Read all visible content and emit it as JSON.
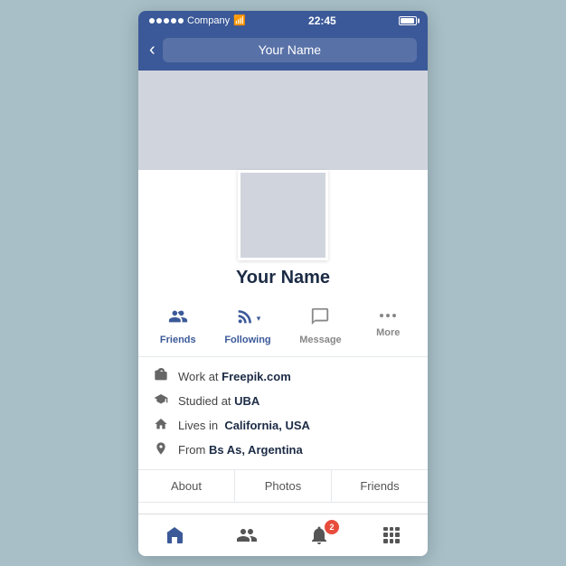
{
  "statusBar": {
    "carrier": "Company",
    "time": "22:45",
    "wifiSymbol": "📶"
  },
  "navBar": {
    "backLabel": "‹",
    "title": "Your Name"
  },
  "profile": {
    "name": "Your Name"
  },
  "actionButtons": [
    {
      "id": "friends",
      "label": "Friends",
      "type": "friends"
    },
    {
      "id": "following",
      "label": "Following",
      "type": "following"
    },
    {
      "id": "message",
      "label": "Message",
      "type": "message"
    },
    {
      "id": "more",
      "label": "More",
      "type": "more"
    }
  ],
  "infoItems": [
    {
      "id": "work",
      "text": "Work at ",
      "highlight": "Freepik.com"
    },
    {
      "id": "studied",
      "text": "Studied at ",
      "highlight": "UBA"
    },
    {
      "id": "lives",
      "text": "Lives in  ",
      "highlight": "California, USA"
    },
    {
      "id": "from",
      "text": "From ",
      "highlight": "Bs As, Argentina"
    }
  ],
  "subTabs": [
    "About",
    "Photos",
    "Friends"
  ],
  "bottomNav": {
    "notificationCount": "2"
  }
}
